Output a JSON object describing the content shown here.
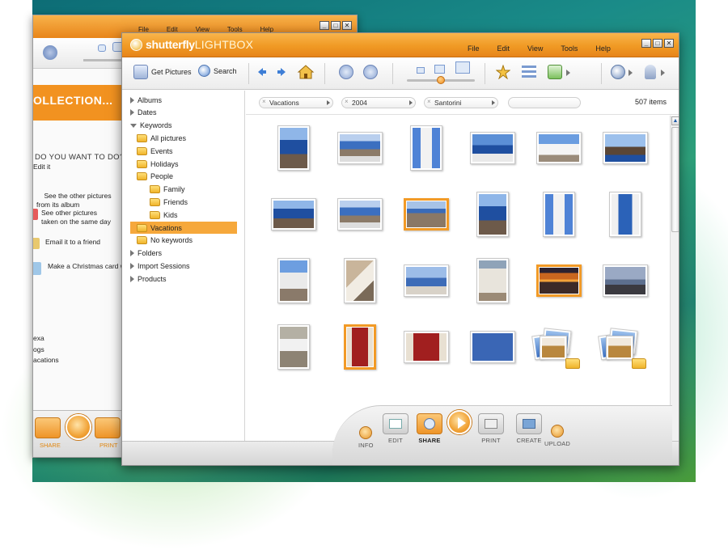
{
  "back_window": {
    "menu": [
      "File",
      "Edit",
      "View",
      "Tools",
      "Help"
    ],
    "banner": "OLLECTION...",
    "question": "DO YOU WANT TO DO?",
    "actions": [
      {
        "label": "Edit it"
      },
      {
        "label": "See the other pictures\nfrom its album"
      },
      {
        "label": "See other pictures\ntaken on the same day"
      },
      {
        "label": "Email it to a friend"
      },
      {
        "label": "Make a Christmas card w"
      }
    ],
    "side_items": [
      "exa",
      "ogs",
      "acations"
    ],
    "bottom_labels": {
      "share": "SHARE",
      "print": "PRINT"
    }
  },
  "app": {
    "logo_brand": "shutterfly",
    "logo_product": "LIGHTBOX",
    "menu": [
      "File",
      "Edit",
      "View",
      "Tools",
      "Help"
    ],
    "window_buttons": [
      "_",
      "□",
      "✕"
    ]
  },
  "toolbar": {
    "get_pictures": "Get Pictures",
    "search": "Search",
    "zoom_level": 0.5
  },
  "sidebar": {
    "items": [
      {
        "label": "Albums",
        "level": 0,
        "arrow": "closed"
      },
      {
        "label": "Dates",
        "level": 0,
        "arrow": "closed"
      },
      {
        "label": "Keywords",
        "level": 0,
        "arrow": "open"
      },
      {
        "label": "All pictures",
        "level": 1,
        "folder": true
      },
      {
        "label": "Events",
        "level": 1,
        "folder": true
      },
      {
        "label": "Holidays",
        "level": 1,
        "folder": true
      },
      {
        "label": "People",
        "level": 1,
        "folder": true
      },
      {
        "label": "Family",
        "level": 2,
        "folder": true
      },
      {
        "label": "Friends",
        "level": 2,
        "folder": true
      },
      {
        "label": "Kids",
        "level": 2,
        "folder": true
      },
      {
        "label": "Vacations",
        "level": 1,
        "folder": true,
        "selected": true
      },
      {
        "label": "No keywords",
        "level": 1,
        "folder": true
      },
      {
        "label": "Folders",
        "level": 0,
        "arrow": "closed"
      },
      {
        "label": "Import Sessions",
        "level": 0,
        "arrow": "closed"
      },
      {
        "label": "Products",
        "level": 0,
        "arrow": "closed"
      }
    ]
  },
  "filters": {
    "crumbs": [
      "Vacations",
      "2004",
      "Santorini"
    ],
    "item_count": "507 items"
  },
  "photos": [
    {
      "kind": "sea-cliff",
      "orient": "portrait"
    },
    {
      "kind": "coast",
      "orient": "landscape"
    },
    {
      "kind": "bell-tower",
      "orient": "portrait"
    },
    {
      "kind": "sea-village",
      "orient": "landscape"
    },
    {
      "kind": "white-village",
      "orient": "landscape"
    },
    {
      "kind": "rock-islet",
      "orient": "landscape"
    },
    {
      "kind": "sea-cliff",
      "orient": "landscape"
    },
    {
      "kind": "coast",
      "orient": "landscape"
    },
    {
      "kind": "cliff-town",
      "orient": "landscape",
      "selected": true
    },
    {
      "kind": "sea-cliff",
      "orient": "portrait"
    },
    {
      "kind": "bell-tower",
      "orient": "portrait"
    },
    {
      "kind": "blue-door",
      "orient": "portrait"
    },
    {
      "kind": "church",
      "orient": "portrait"
    },
    {
      "kind": "stairs",
      "orient": "portrait"
    },
    {
      "kind": "person-sea",
      "orient": "landscape"
    },
    {
      "kind": "arch",
      "orient": "portrait"
    },
    {
      "kind": "sunset",
      "orient": "landscape",
      "selected": true
    },
    {
      "kind": "dusk-rock",
      "orient": "landscape"
    },
    {
      "kind": "aerial",
      "orient": "portrait"
    },
    {
      "kind": "red-door",
      "orient": "portrait",
      "selected": true
    },
    {
      "kind": "red-door",
      "orient": "landscape"
    },
    {
      "kind": "sign",
      "orient": "landscape"
    },
    {
      "kind": "album-stack",
      "orient": "stack"
    },
    {
      "kind": "album-stack",
      "orient": "stack"
    }
  ],
  "dock": {
    "info": "INFO",
    "edit": "EDIT",
    "share": "SHARE",
    "print": "PRINT",
    "create": "CREATE",
    "upload": "UPLOAD"
  },
  "colors": {
    "accent": "#f09a24",
    "selection": "#f6a83b"
  }
}
